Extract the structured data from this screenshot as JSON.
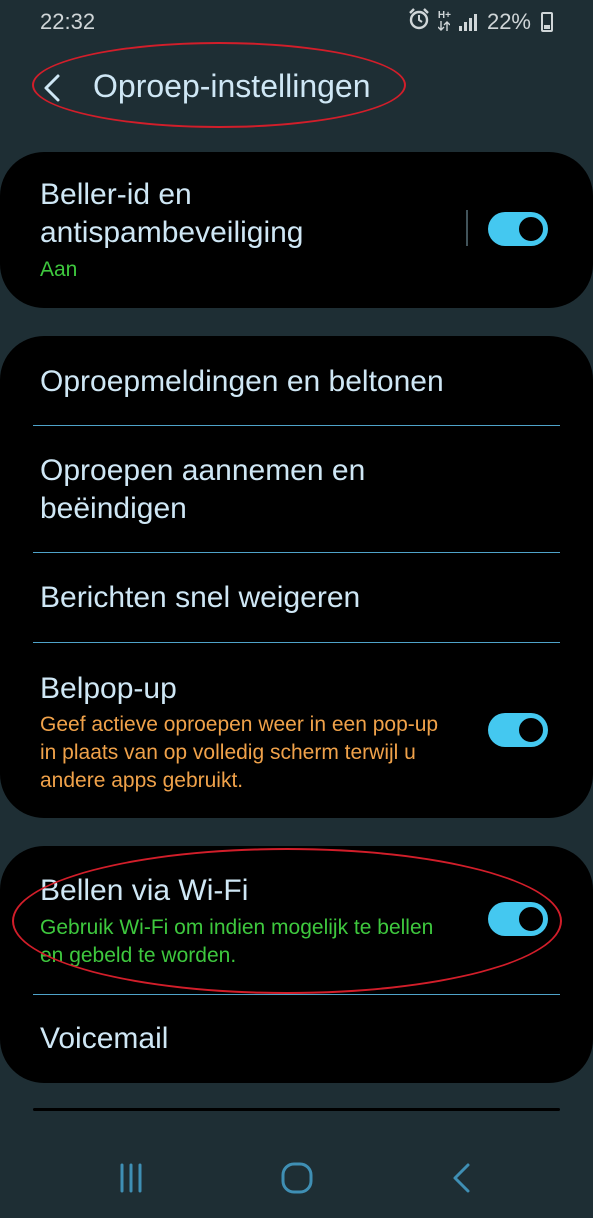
{
  "status_bar": {
    "time": "22:32",
    "battery_percent": "22%",
    "network_label": "H+",
    "icons": [
      "alarm-icon",
      "network-h-plus-icon",
      "signal-icon",
      "battery-icon"
    ]
  },
  "header": {
    "title": "Oproep-instellingen",
    "back_icon": "chevron-left-icon"
  },
  "caller_id": {
    "title": "Beller-id en antispambeveiliging",
    "status": "Aan",
    "status_color": "#3ec83e",
    "toggle_on": true
  },
  "menu": {
    "items": [
      {
        "title": "Oproepmeldingen en beltonen"
      },
      {
        "title": "Oproepen aannemen en beëindigen"
      },
      {
        "title": "Berichten snel weigeren"
      },
      {
        "title": "Belpop-up",
        "subtitle": "Geef actieve oproepen weer in een pop-up in plaats van op volledig scherm terwijl u andere apps gebruikt.",
        "subtitle_color": "#f0a24a",
        "toggle_on": true
      }
    ]
  },
  "wifi_section": {
    "wifi_calling": {
      "title": "Bellen via Wi-Fi",
      "subtitle": "Gebruik Wi-Fi om indien mogelijk te bellen en gebeld te worden.",
      "subtitle_color": "#3ec83e",
      "toggle_on": true
    },
    "voicemail": {
      "title": "Voicemail"
    }
  },
  "nav_bar": {
    "icons": [
      "recent-apps-icon",
      "home-icon",
      "back-icon"
    ]
  },
  "colors": {
    "background": "#1e2e34",
    "card": "#000000",
    "text": "#cfe7f5",
    "accent": "#44c8f0",
    "divider": "#4fa3c9",
    "annotation": "#d21e2a"
  }
}
